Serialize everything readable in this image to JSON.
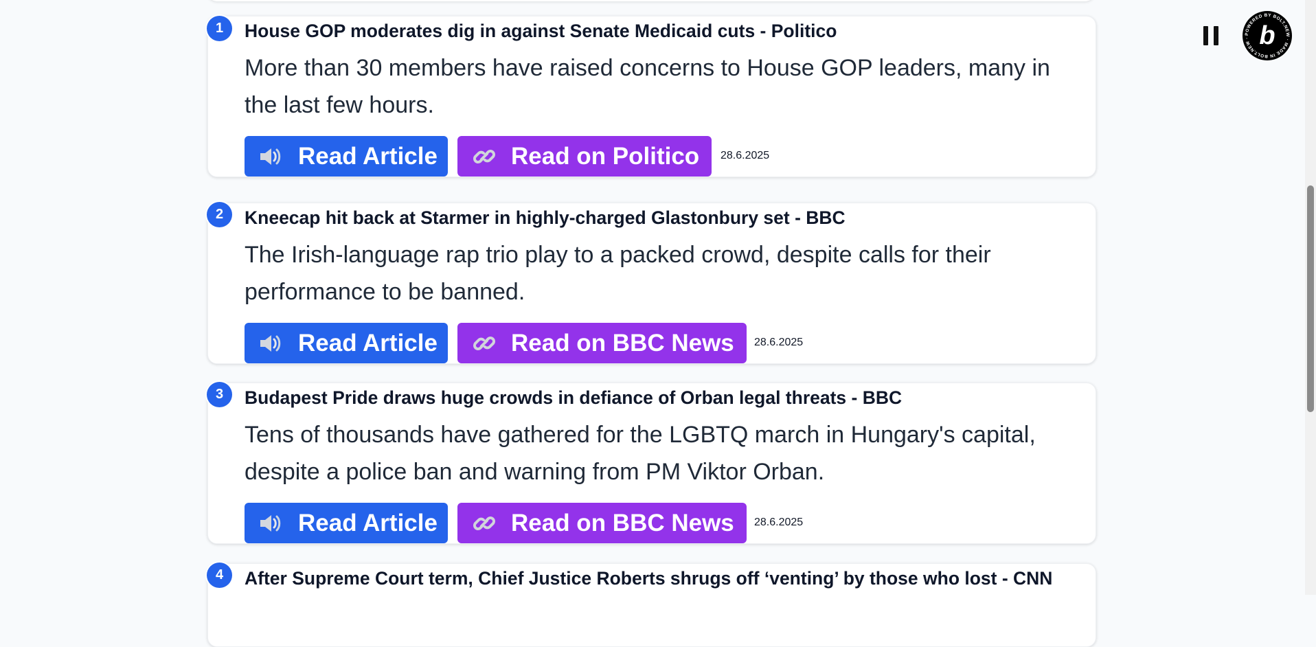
{
  "articles": [
    {
      "number": "1",
      "title": "House GOP moderates dig in against Senate Medicaid cuts - Politico",
      "description": "More than 30 members have raised concerns to House GOP leaders, many in the last few hours.",
      "read_label": "Read Article",
      "source_label": "Read on Politico",
      "date": "28.6.2025"
    },
    {
      "number": "2",
      "title": "Kneecap hit back at Starmer in highly-charged Glastonbury set - BBC",
      "description": "The Irish-language rap trio play to a packed crowd, despite calls for their performance to be banned.",
      "read_label": "Read Article",
      "source_label": "Read on BBC News",
      "date": "28.6.2025"
    },
    {
      "number": "3",
      "title": "Budapest Pride draws huge crowds in defiance of Orban legal threats - BBC",
      "description": "Tens of thousands have gathered for the LGBTQ march in Hungary's capital, despite a police ban and warning from PM Viktor Orban.",
      "read_label": "Read Article",
      "source_label": "Read on BBC News",
      "date": "28.6.2025"
    },
    {
      "number": "4",
      "title": "After Supreme Court term, Chief Justice Roberts shrugs off ‘venting’ by those who lost - CNN"
    }
  ],
  "icons": {
    "read": "speaker-icon",
    "source": "link-icon",
    "player": "pause-icon",
    "badge": "bolt-badge-icon"
  },
  "badge": {
    "letter": "b",
    "ring_text": "POWERED BY BOLT.NEW · MADE IN BOLT.NEW · "
  },
  "colors": {
    "accent_blue": "#2563eb",
    "accent_purple": "#9333ea",
    "page_background": "#f8fafc"
  }
}
